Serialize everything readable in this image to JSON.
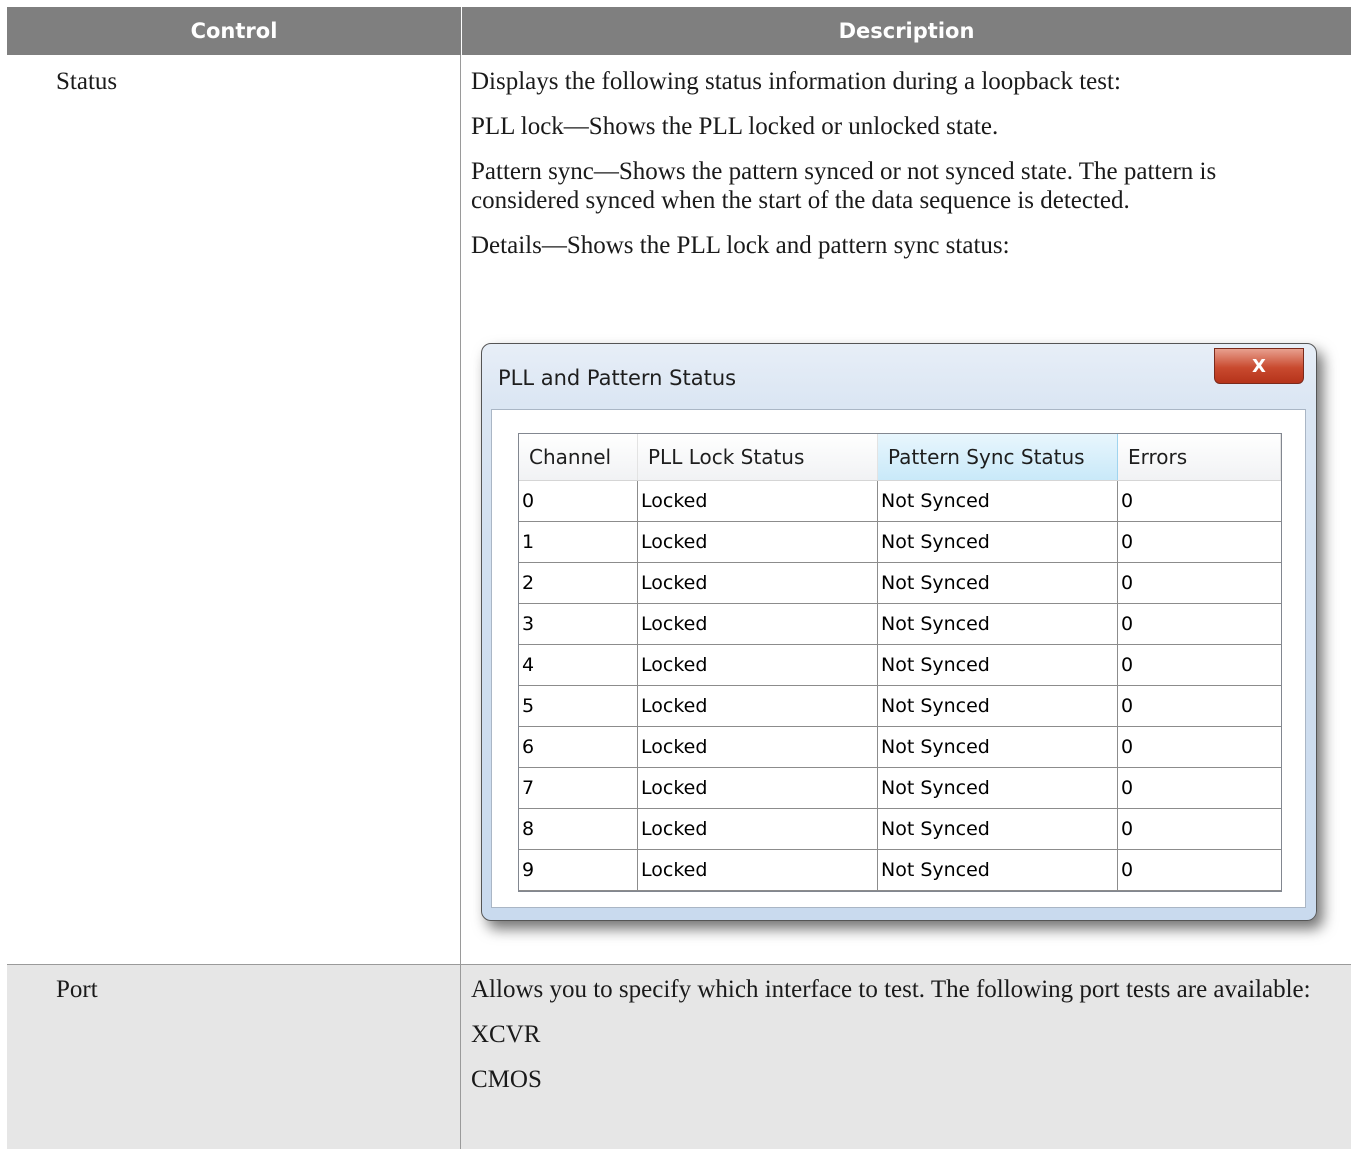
{
  "table": {
    "header": {
      "control": "Control",
      "description": "Description"
    },
    "rows": [
      {
        "control": "Status",
        "paragraphs": [
          "Displays the following status information during a loopback test:",
          "PLL lock—Shows the PLL locked or unlocked state.",
          "Pattern sync—Shows the pattern synced or not synced state. The pattern is considered synced when the start of the data sequence is detected.",
          "Details—Shows the PLL lock and pattern sync status:"
        ]
      },
      {
        "control": "Port",
        "paragraphs": [
          "Allows you to specify which interface to test. The following port tests are available:",
          "XCVR",
          "CMOS"
        ]
      }
    ]
  },
  "dialog": {
    "title": "PLL and Pattern Status",
    "close_icon": "close-x-icon",
    "close_label": "X",
    "columns": [
      "Channel",
      "PLL Lock Status",
      "Pattern Sync Status",
      "Errors"
    ],
    "rows": [
      [
        "0",
        "Locked",
        "Not Synced",
        "0"
      ],
      [
        "1",
        "Locked",
        "Not Synced",
        "0"
      ],
      [
        "2",
        "Locked",
        "Not Synced",
        "0"
      ],
      [
        "3",
        "Locked",
        "Not Synced",
        "0"
      ],
      [
        "4",
        "Locked",
        "Not Synced",
        "0"
      ],
      [
        "5",
        "Locked",
        "Not Synced",
        "0"
      ],
      [
        "6",
        "Locked",
        "Not Synced",
        "0"
      ],
      [
        "7",
        "Locked",
        "Not Synced",
        "0"
      ],
      [
        "8",
        "Locked",
        "Not Synced",
        "0"
      ],
      [
        "9",
        "Locked",
        "Not Synced",
        "0"
      ]
    ]
  }
}
